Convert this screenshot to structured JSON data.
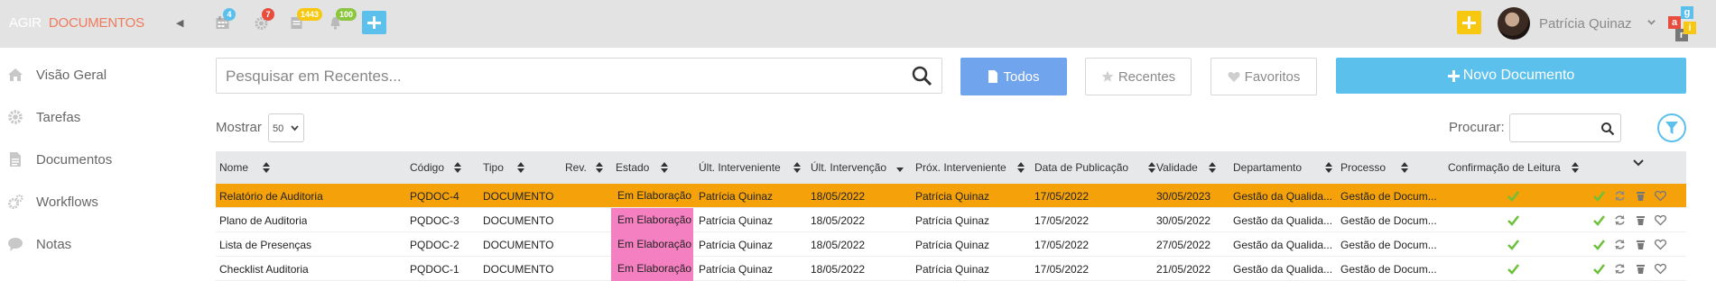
{
  "brand": {
    "part1": "AGIR",
    "part2": "DOCUMENTOS"
  },
  "topbar": {
    "badges": [
      {
        "icon": "calendar-icon",
        "count": "4",
        "color": "#5bc0eb"
      },
      {
        "icon": "gear-icon",
        "count": "7",
        "color": "#e84c3d"
      },
      {
        "icon": "document-icon",
        "count": "1443",
        "color": "#f7c80f"
      },
      {
        "icon": "bell-icon",
        "count": "100",
        "color": "#8cc63e"
      }
    ],
    "user_name": "Patrícia Quinaz",
    "logo_letters": [
      "a",
      "g",
      "r",
      "i"
    ]
  },
  "sidebar": {
    "items": [
      {
        "label": "Visão Geral",
        "icon": "home-icon"
      },
      {
        "label": "Tarefas",
        "icon": "gear-icon"
      },
      {
        "label": "Documentos",
        "icon": "document-icon"
      },
      {
        "label": "Workflows",
        "icon": "gears-icon"
      },
      {
        "label": "Notas",
        "icon": "chat-icon"
      }
    ]
  },
  "search": {
    "placeholder": "Pesquisar em Recentes..."
  },
  "filters": {
    "todos": "Todos",
    "recentes": "Recentes",
    "favoritos": "Favoritos",
    "active": "Todos"
  },
  "new_doc": "Novo Documento",
  "table_controls": {
    "show_label": "Mostrar",
    "page_size": "50",
    "search_label": "Procurar:"
  },
  "table": {
    "headers": [
      "Nome",
      "Código",
      "Tipo",
      "Rev.",
      "Estado",
      "Últ. Interveniente",
      "Últ. Intervenção",
      "Próx. Interveniente",
      "Data de Publicação",
      "Validade",
      "Departamento",
      "Processo",
      "Confirmação de Leitura"
    ],
    "rows": [
      {
        "nome": "Relatório de Auditoria",
        "codigo": "PQDOC-4",
        "tipo": "DOCUMENTO",
        "rev": "",
        "estado": "Em Elaboração",
        "ult_interveniente": "Patrícia Quinaz",
        "ult_intervencao": "18/05/2022",
        "prox_interveniente": "Patrícia Quinaz",
        "data_publicacao": "17/05/2022",
        "validade": "30/05/2023",
        "departamento": "Gestão da Qualida...",
        "processo": "Gestão de Docum..."
      },
      {
        "nome": "Plano de Auditoria",
        "codigo": "PQDOC-3",
        "tipo": "DOCUMENTO",
        "rev": "",
        "estado": "Em Elaboração",
        "ult_interveniente": "Patrícia Quinaz",
        "ult_intervencao": "18/05/2022",
        "prox_interveniente": "Patrícia Quinaz",
        "data_publicacao": "17/05/2022",
        "validade": "30/05/2022",
        "departamento": "Gestão da Qualida...",
        "processo": "Gestão de Docum..."
      },
      {
        "nome": "Lista de Presenças",
        "codigo": "PQDOC-2",
        "tipo": "DOCUMENTO",
        "rev": "",
        "estado": "Em Elaboração",
        "ult_interveniente": "Patrícia Quinaz",
        "ult_intervencao": "18/05/2022",
        "prox_interveniente": "Patrícia Quinaz",
        "data_publicacao": "17/05/2022",
        "validade": "27/05/2022",
        "departamento": "Gestão da Qualida...",
        "processo": "Gestão de Docum..."
      },
      {
        "nome": "Checklist Auditoria",
        "codigo": "PQDOC-1",
        "tipo": "DOCUMENTO",
        "rev": "",
        "estado": "Em Elaboração",
        "ult_interveniente": "Patrícia Quinaz",
        "ult_intervencao": "18/05/2022",
        "prox_interveniente": "Patrícia Quinaz",
        "data_publicacao": "17/05/2022",
        "validade": "21/05/2022",
        "departamento": "Gestão da Qualida...",
        "processo": "Gestão de Docum..."
      }
    ]
  },
  "colors": {
    "accent": "#5bc0eb",
    "active_button": "#70a4ec",
    "selected_row": "#f5a20a",
    "status_pink": "#f580c1",
    "check_green": "#6cc03a"
  }
}
